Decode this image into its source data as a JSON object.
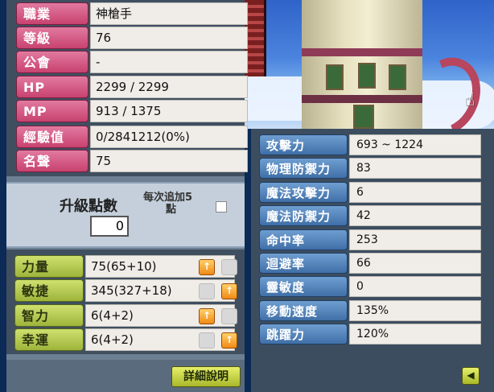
{
  "profile": [
    {
      "label": "職業",
      "value": "神槍手"
    },
    {
      "label": "等級",
      "value": "76"
    },
    {
      "label": "公會",
      "value": "-"
    },
    {
      "label": "HP",
      "value": "2299 / 2299"
    },
    {
      "label": "MP",
      "value": "913 / 1375"
    },
    {
      "label": "經驗值",
      "value": "0/2841212(0%)"
    },
    {
      "label": "名聲",
      "value": "75"
    }
  ],
  "points": {
    "label": "升級點數",
    "value": "0",
    "add5_label_line1": "每次追加5",
    "add5_label_line2": "點"
  },
  "abilities": [
    {
      "label": "力量",
      "value": "75(65+10)"
    },
    {
      "label": "敏捷",
      "value": "345(327+18)"
    },
    {
      "label": "智力",
      "value": "6(4+2)"
    },
    {
      "label": "幸運",
      "value": "6(4+2)"
    }
  ],
  "detail_button": "詳細說明",
  "details": [
    {
      "label": "攻擊力",
      "value": "693 ~ 1224"
    },
    {
      "label": "物理防禦力",
      "value": "83"
    },
    {
      "label": "魔法攻擊力",
      "value": "6"
    },
    {
      "label": "魔法防禦力",
      "value": "42"
    },
    {
      "label": "命中率",
      "value": "253"
    },
    {
      "label": "迴避率",
      "value": "66"
    },
    {
      "label": "靈敏度",
      "value": "0"
    },
    {
      "label": "移動速度",
      "value": "135%"
    },
    {
      "label": "跳躍力",
      "value": "120%"
    }
  ],
  "icons": {
    "up": "up-arrow-icon",
    "back": "back-arrow-icon",
    "cursor": "hand-cursor-icon"
  }
}
